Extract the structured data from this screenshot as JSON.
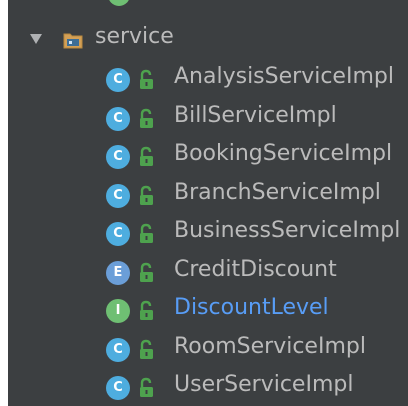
{
  "colors": {
    "background": "#3c3f41",
    "text": "#bbbbbb",
    "interface_text": "#589df6",
    "class_icon": "#4eaddf",
    "enum_icon": "#6b9ed8",
    "interface_icon": "#6fbf73",
    "lock_icon": "#4ea24e"
  },
  "tree": {
    "folder": {
      "label": "service",
      "icon": "folder-icon",
      "expanded": true
    },
    "items": [
      {
        "label": "AnalysisServiceImpl",
        "kind": "C",
        "icon": "class-icon"
      },
      {
        "label": "BillServiceImpl",
        "kind": "C",
        "icon": "class-icon"
      },
      {
        "label": "BookingServiceImpl",
        "kind": "C",
        "icon": "class-icon"
      },
      {
        "label": "BranchServiceImpl",
        "kind": "C",
        "icon": "class-icon"
      },
      {
        "label": "BusinessServiceImpl",
        "kind": "C",
        "icon": "class-icon"
      },
      {
        "label": "CreditDiscount",
        "kind": "E",
        "icon": "enum-icon"
      },
      {
        "label": "DiscountLevel",
        "kind": "I",
        "icon": "interface-icon"
      },
      {
        "label": "RoomServiceImpl",
        "kind": "C",
        "icon": "class-icon"
      },
      {
        "label": "UserServiceImpl",
        "kind": "C",
        "icon": "class-icon"
      }
    ]
  }
}
